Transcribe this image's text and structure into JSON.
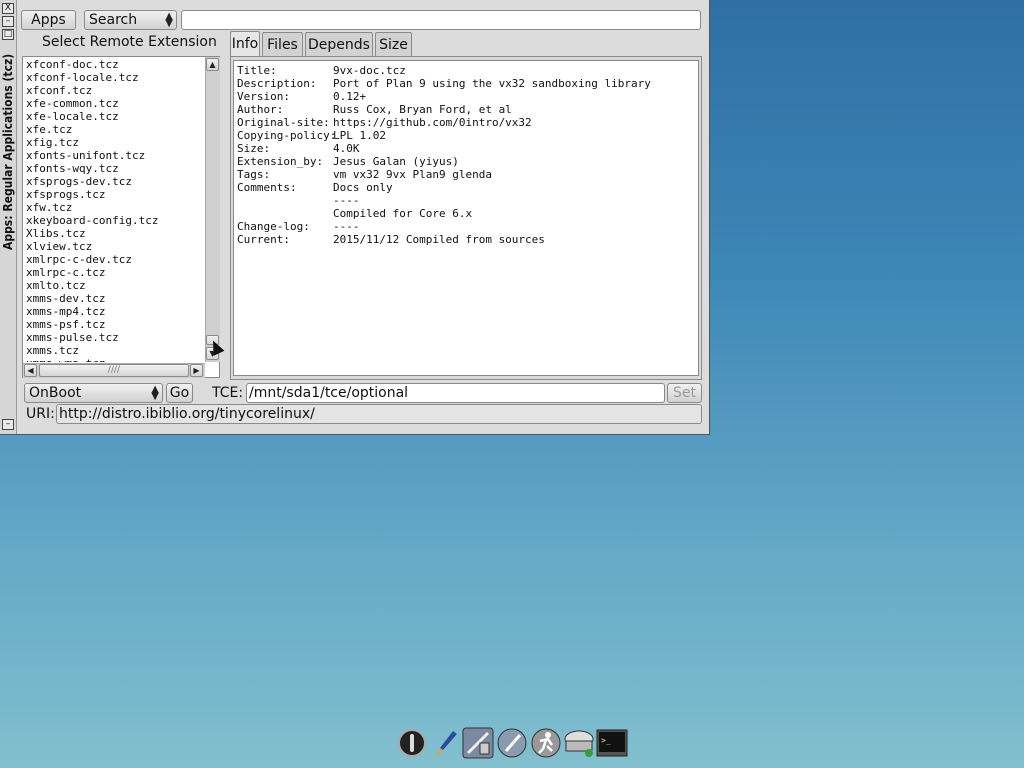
{
  "window": {
    "vertical_title": "Apps: Regular Applications (tcz)",
    "titlebar_buttons": [
      "X",
      "–",
      "□"
    ]
  },
  "toolbar": {
    "apps_label": "Apps",
    "search_select": "Search",
    "search_value": ""
  },
  "left": {
    "heading": "Select Remote Extension",
    "items": [
      "xfconf-doc.tcz",
      "xfconf-locale.tcz",
      "xfconf.tcz",
      "xfe-common.tcz",
      "xfe-locale.tcz",
      "xfe.tcz",
      "xfig.tcz",
      "xfonts-unifont.tcz",
      "xfonts-wqy.tcz",
      "xfsprogs-dev.tcz",
      "xfsprogs.tcz",
      "xfw.tcz",
      "xkeyboard-config.tcz",
      "Xlibs.tcz",
      "xlview.tcz",
      "xmlrpc-c-dev.tcz",
      "xmlrpc-c.tcz",
      "xmlto.tcz",
      "xmms-dev.tcz",
      "xmms-mp4.tcz",
      "xmms-psf.tcz",
      "xmms-pulse.tcz",
      "xmms.tcz",
      "xmms-wma.tcz"
    ]
  },
  "tabs": [
    "Info",
    "Files",
    "Depends",
    "Size"
  ],
  "info": [
    {
      "key": "Title:",
      "value": "9vx-doc.tcz"
    },
    {
      "key": "Description:",
      "value": "Port of Plan 9 using the vx32 sandboxing library"
    },
    {
      "key": "Version:",
      "value": "0.12+"
    },
    {
      "key": "Author:",
      "value": "Russ Cox, Bryan Ford, et al"
    },
    {
      "key": "Original-site:",
      "value": "https://github.com/0intro/vx32"
    },
    {
      "key": "Copying-policy:",
      "value": "LPL 1.02"
    },
    {
      "key": "Size:",
      "value": "4.0K"
    },
    {
      "key": "Extension_by:",
      "value": "Jesus Galan (yiyus)"
    },
    {
      "key": "Tags:",
      "value": "vm vx32 9vx Plan9 glenda"
    },
    {
      "key": "Comments:",
      "value": "Docs only"
    },
    {
      "key": "",
      "value": "----"
    },
    {
      "key": "",
      "value": "Compiled for Core 6.x"
    },
    {
      "key": "Change-log:",
      "value": "----"
    },
    {
      "key": "Current:",
      "value": "2015/11/12 Compiled from sources"
    }
  ],
  "bottom": {
    "onboot_select": "OnBoot",
    "go_label": "Go",
    "tce_label": "TCE:",
    "tce_value": "/mnt/sda1/tce/optional",
    "set_label": "Set",
    "uri_label": "URI:",
    "uri_value": "http://distro.ibiblio.org/tinycorelinux/"
  },
  "taskbar": [
    "power-icon",
    "paintbrush-icon",
    "settings-grid-icon",
    "mount-icon",
    "runner-icon",
    "package-icon",
    "terminal-icon"
  ]
}
